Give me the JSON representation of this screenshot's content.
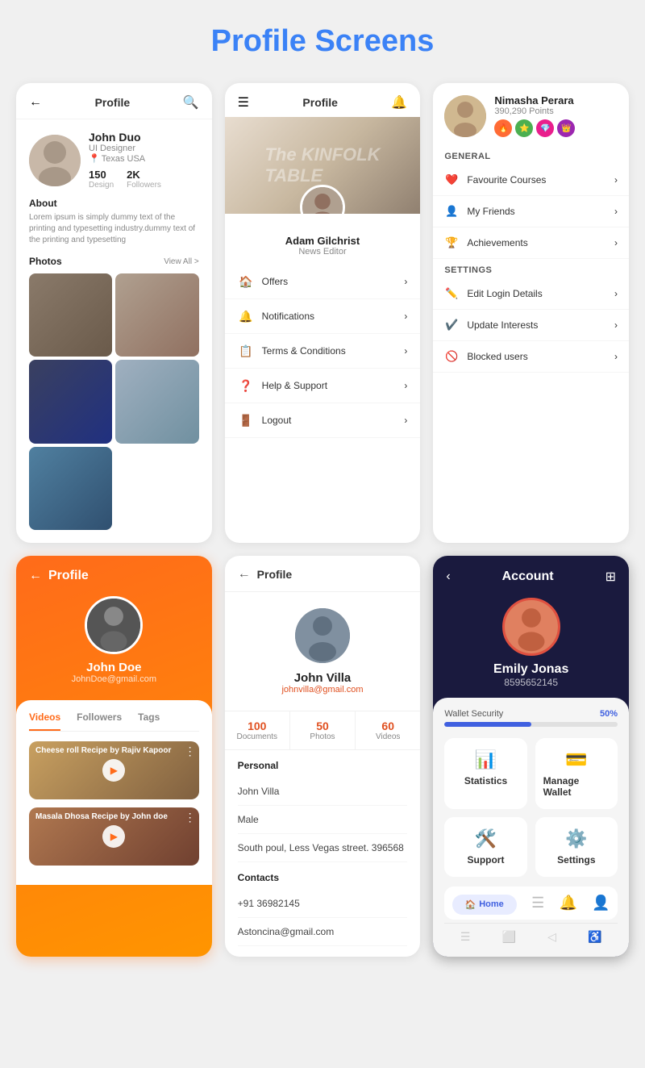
{
  "page": {
    "title": "Profile",
    "title_highlight": "Screens"
  },
  "screen1": {
    "header_title": "Profile",
    "user_name": "John Duo",
    "user_role": "UI Designer",
    "user_location": "Texas USA",
    "stat_design_val": "150",
    "stat_design_label": "Design",
    "stat_followers_val": "2K",
    "stat_followers_label": "Followers",
    "about_title": "About",
    "about_text": "Lorem ipsum is simply dummy text of the printing and typesetting industry.dummy text of the printing and typesetting",
    "photos_title": "Photos",
    "view_all": "View All >"
  },
  "screen2": {
    "header_title": "Profile",
    "cover_text": "The KINFOLK TABLE",
    "profile_name": "Adam Gilchrist",
    "profile_role": "News Editor",
    "menu_items": [
      {
        "icon": "🏠",
        "label": "Offers"
      },
      {
        "icon": "🔔",
        "label": "Notifications"
      },
      {
        "icon": "📋",
        "label": "Terms & Conditions"
      },
      {
        "icon": "❓",
        "label": "Help & Support"
      },
      {
        "icon": "🚪",
        "label": "Logout"
      }
    ]
  },
  "screen3": {
    "user_name": "Nimasha Perara",
    "user_points": "390,290 Points",
    "general_title": "GENERAL",
    "general_items": [
      {
        "icon": "❤️",
        "label": "Favourite Courses"
      },
      {
        "icon": "👤",
        "label": "My Friends"
      },
      {
        "icon": "🏆",
        "label": "Achievements"
      }
    ],
    "settings_title": "SETTINGS",
    "settings_items": [
      {
        "icon": "✏️",
        "label": "Edit Login Details"
      },
      {
        "icon": "✔️",
        "label": "Update Interests"
      },
      {
        "icon": "🚫",
        "label": "Blocked users"
      }
    ]
  },
  "screen4": {
    "header_title": "Profile",
    "profile_name": "John Doe",
    "profile_email": "JohnDoe@gmail.com",
    "tabs": [
      "Videos",
      "Followers",
      "Tags"
    ],
    "videos": [
      {
        "title": "Cheese roll Recipe by Rajiv Kapoor"
      },
      {
        "title": "Masala Dhosa Recipe by John doe"
      }
    ]
  },
  "screen5": {
    "header_title": "Profile",
    "profile_name": "John Villa",
    "profile_email": "johnvilla@gmail.com",
    "stats": [
      {
        "val": "100",
        "label": "Documents"
      },
      {
        "val": "50",
        "label": "Photos"
      },
      {
        "val": "60",
        "label": "Videos"
      }
    ],
    "personal_title": "Personal",
    "personal_fields": [
      "John Villa",
      "Male",
      "South poul, Less Vegas street. 396568"
    ],
    "contacts_title": "Contacts",
    "contact_fields": [
      "+91 36982145",
      "Astoncina@gmail.com"
    ]
  },
  "screen6": {
    "header_title": "Account",
    "user_name": "Emily Jonas",
    "user_phone": "8595652145",
    "progress_label": "Wallet Security",
    "progress_val": "50%",
    "progress_pct": 50,
    "grid_items": [
      {
        "icon": "📊",
        "label": "Statistics"
      },
      {
        "icon": "💳",
        "label": "Manage Wallet"
      },
      {
        "icon": "🛠️",
        "label": "Support"
      },
      {
        "icon": "⚙️",
        "label": "Settings"
      }
    ],
    "nav_items": [
      "🏠",
      "☰",
      "🔔",
      "👤"
    ]
  }
}
